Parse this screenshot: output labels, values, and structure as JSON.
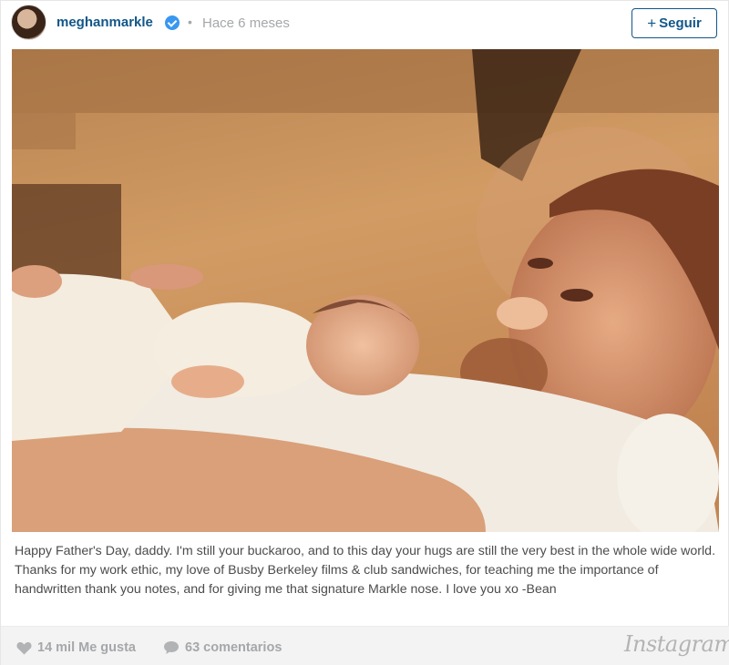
{
  "header": {
    "username": "meghanmarkle",
    "separator": "•",
    "timestamp": "Hace 6 meses",
    "follow_label": "Seguir",
    "follow_plus": "+"
  },
  "caption": "Happy Father's Day, daddy. I'm still your buckaroo, and to this day your hugs are still the very best in the whole wide world. Thanks for my work ethic, my love of Busby Berkeley films & club sandwiches, for teaching me the importance of handwritten thank you notes, and for giving me that signature Markle nose. I love you xo -Bean",
  "footer": {
    "likes": "14 mil Me gusta",
    "comments": "63 comentarios",
    "brand": "Instagram"
  },
  "colors": {
    "username": "#125688",
    "verified": "#3897f0",
    "muted": "#a5a7aa"
  },
  "icons": {
    "verified": "verified-badge-icon",
    "likes": "heart-icon",
    "comments": "comment-bubble-icon"
  }
}
